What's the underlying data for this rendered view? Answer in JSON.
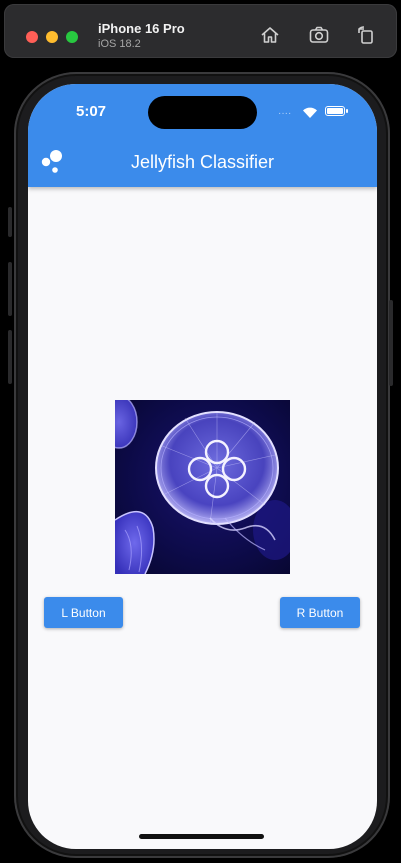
{
  "simulator": {
    "device_name": "iPhone 16 Pro",
    "os_version": "iOS 18.2",
    "toolbar_icons": [
      "home-icon",
      "screenshot-icon",
      "rotate-icon"
    ]
  },
  "status_bar": {
    "time": "5:07",
    "signal_dots": "····"
  },
  "app_bar": {
    "title": "Jellyfish Classifier",
    "logo": "bubbles-logo-icon",
    "color": "#3b8beb"
  },
  "main": {
    "image_subject": "moon jellyfish",
    "left_button_label": "L Button",
    "right_button_label": "R Button",
    "button_color": "#3b8beb"
  }
}
